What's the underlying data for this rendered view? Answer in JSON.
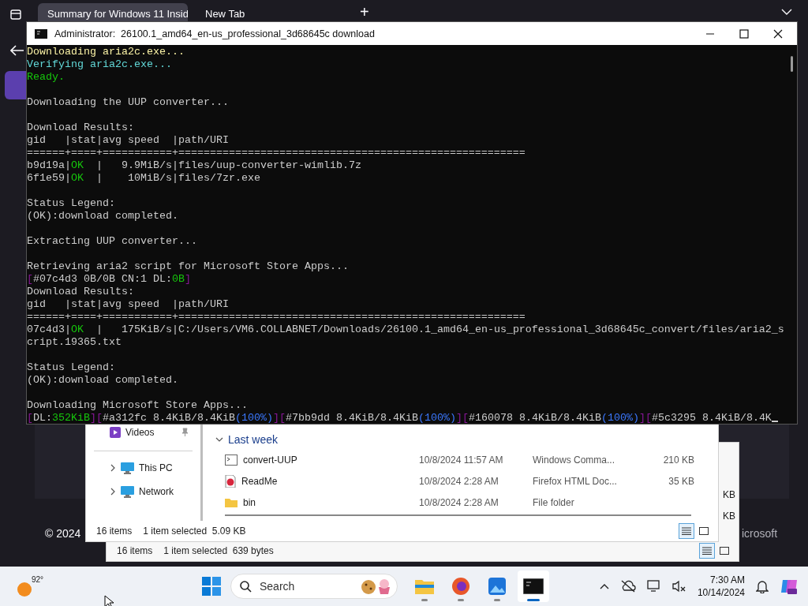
{
  "browser": {
    "tabs": [
      {
        "title": "Summary for Windows 11 Insid",
        "selected": true
      },
      {
        "title": "New Tab",
        "selected": false
      }
    ],
    "new_tab": "+",
    "footer_left": "© 2024",
    "footer_right": "icrosoft"
  },
  "console": {
    "title": "Administrator:  26100.1_amd64_en-us_professional_3d68645c download",
    "blocks": [
      {
        "lines": [
          {
            "segments": [
              {
                "text": "Downloading aria2c.exe...",
                "color": "#f9f1a5"
              }
            ]
          },
          {
            "segments": [
              {
                "text": "Verifying aria2c.exe...",
                "color": "#61d6d6"
              }
            ]
          },
          {
            "segments": [
              {
                "text": "Ready.",
                "color": "#16c60c"
              }
            ]
          }
        ]
      },
      {
        "lines": [
          {
            "segments": [
              {
                "text": "Downloading the UUP converter...",
                "color": "#cccccc"
              }
            ]
          }
        ]
      },
      {
        "lines": [
          {
            "segments": [
              {
                "text": "Download Results:",
                "color": "#cccccc"
              }
            ]
          },
          {
            "segments": [
              {
                "text": "gid   |stat|avg speed  |path/URI",
                "color": "#cccccc"
              }
            ]
          },
          {
            "segments": [
              {
                "text": "======+====+===========+=======================================================",
                "color": "#cccccc"
              }
            ]
          },
          {
            "segments": [
              {
                "text": "b9d19a|",
                "color": "#cccccc"
              },
              {
                "text": "OK",
                "color": "#16c60c"
              },
              {
                "text": "  |   9.9MiB/s|files/uup-converter-wimlib.7z",
                "color": "#cccccc"
              }
            ]
          },
          {
            "segments": [
              {
                "text": "6f1e59|",
                "color": "#cccccc"
              },
              {
                "text": "OK",
                "color": "#16c60c"
              },
              {
                "text": "  |    10MiB/s|files/7zr.exe",
                "color": "#cccccc"
              }
            ]
          }
        ]
      },
      {
        "lines": [
          {
            "segments": [
              {
                "text": "Status Legend:",
                "color": "#cccccc"
              }
            ]
          },
          {
            "segments": [
              {
                "text": "(OK):download completed.",
                "color": "#cccccc"
              }
            ]
          }
        ]
      },
      {
        "lines": [
          {
            "segments": [
              {
                "text": "Extracting UUP converter...",
                "color": "#cccccc"
              }
            ]
          }
        ]
      },
      {
        "lines": [
          {
            "segments": [
              {
                "text": "Retrieving aria2 script for Microsoft Store Apps...",
                "color": "#cccccc"
              }
            ]
          },
          {
            "segments": [
              {
                "text": "[",
                "color": "#881798"
              },
              {
                "text": "#07c4d3 0B/0B CN:1 DL:",
                "color": "#cccccc"
              },
              {
                "text": "0B",
                "color": "#16c60c"
              },
              {
                "text": "]",
                "color": "#881798"
              }
            ]
          },
          {
            "segments": [
              {
                "text": "Download Results:",
                "color": "#cccccc"
              }
            ]
          },
          {
            "segments": [
              {
                "text": "gid   |stat|avg speed  |path/URI",
                "color": "#cccccc"
              }
            ]
          },
          {
            "segments": [
              {
                "text": "======+====+===========+=======================================================",
                "color": "#cccccc"
              }
            ]
          },
          {
            "segments": [
              {
                "text": "07c4d3|",
                "color": "#cccccc"
              },
              {
                "text": "OK",
                "color": "#16c60c"
              },
              {
                "text": "  |   175KiB/s|C:/Users/VM6.COLLABNET/Downloads/26100.1_amd64_en-us_professional_3d68645c_convert/files/aria2_s",
                "color": "#cccccc"
              }
            ]
          },
          {
            "segments": [
              {
                "text": "cript.19365.txt",
                "color": "#cccccc"
              }
            ]
          }
        ]
      },
      {
        "lines": [
          {
            "segments": [
              {
                "text": "Status Legend:",
                "color": "#cccccc"
              }
            ]
          },
          {
            "segments": [
              {
                "text": "(OK):download completed.",
                "color": "#cccccc"
              }
            ]
          }
        ]
      },
      {
        "lines": [
          {
            "segments": [
              {
                "text": "Downloading Microsoft Store Apps...",
                "color": "#cccccc"
              }
            ]
          },
          {
            "segments": [
              {
                "text": "[",
                "color": "#881798"
              },
              {
                "text": "DL:",
                "color": "#cccccc"
              },
              {
                "text": "352KiB",
                "color": "#16c60c"
              },
              {
                "text": "]",
                "color": "#881798"
              },
              {
                "text": "[",
                "color": "#881798"
              },
              {
                "text": "#a312fc 8.4KiB/8.4KiB",
                "color": "#cccccc"
              },
              {
                "text": "(100%)",
                "color": "#3b78ff"
              },
              {
                "text": "]",
                "color": "#881798"
              },
              {
                "text": "[",
                "color": "#881798"
              },
              {
                "text": "#7bb9dd 8.4KiB/8.4KiB",
                "color": "#cccccc"
              },
              {
                "text": "(100%)",
                "color": "#3b78ff"
              },
              {
                "text": "]",
                "color": "#881798"
              },
              {
                "text": "[",
                "color": "#881798"
              },
              {
                "text": "#160078 8.4KiB/8.4KiB",
                "color": "#cccccc"
              },
              {
                "text": "(100%)",
                "color": "#3b78ff"
              },
              {
                "text": "]",
                "color": "#881798"
              },
              {
                "text": "[",
                "color": "#881798"
              },
              {
                "text": "#5c3295 8.4KiB/8.4K",
                "color": "#cccccc"
              }
            ]
          }
        ]
      }
    ]
  },
  "explorer_front": {
    "nav_items": [
      {
        "label": "Videos",
        "kind": "pinned"
      },
      {
        "label": "This PC",
        "kind": "expandable"
      },
      {
        "label": "Network",
        "kind": "expandable"
      }
    ],
    "group": "Last week",
    "files": [
      {
        "name": "convert-UUP",
        "date": "10/8/2024 11:57 AM",
        "type": "Windows Comma...",
        "size": "210 KB",
        "kind": "script"
      },
      {
        "name": "ReadMe",
        "date": "10/8/2024 2:28 AM",
        "type": "Firefox HTML Doc...",
        "size": "35 KB",
        "kind": "html"
      },
      {
        "name": "bin",
        "date": "10/8/2024 2:28 AM",
        "type": "File folder",
        "kind": "folder"
      }
    ],
    "status_count": "16 items",
    "status_selected": "1 item selected  5.09 KB"
  },
  "explorer_back": {
    "sizes": [
      "KB",
      "KB"
    ],
    "status_count": "16 items",
    "status_selected": "1 item selected  639 bytes"
  },
  "taskbar": {
    "temperature": "92°",
    "search_placeholder": "Search",
    "apps": [
      {
        "kind": "explorer",
        "selected": false
      },
      {
        "kind": "firefox",
        "selected": false
      },
      {
        "kind": "photos",
        "selected": false
      },
      {
        "kind": "terminal",
        "selected": true
      }
    ],
    "time": "7:30 AM",
    "date": "10/14/2024"
  }
}
